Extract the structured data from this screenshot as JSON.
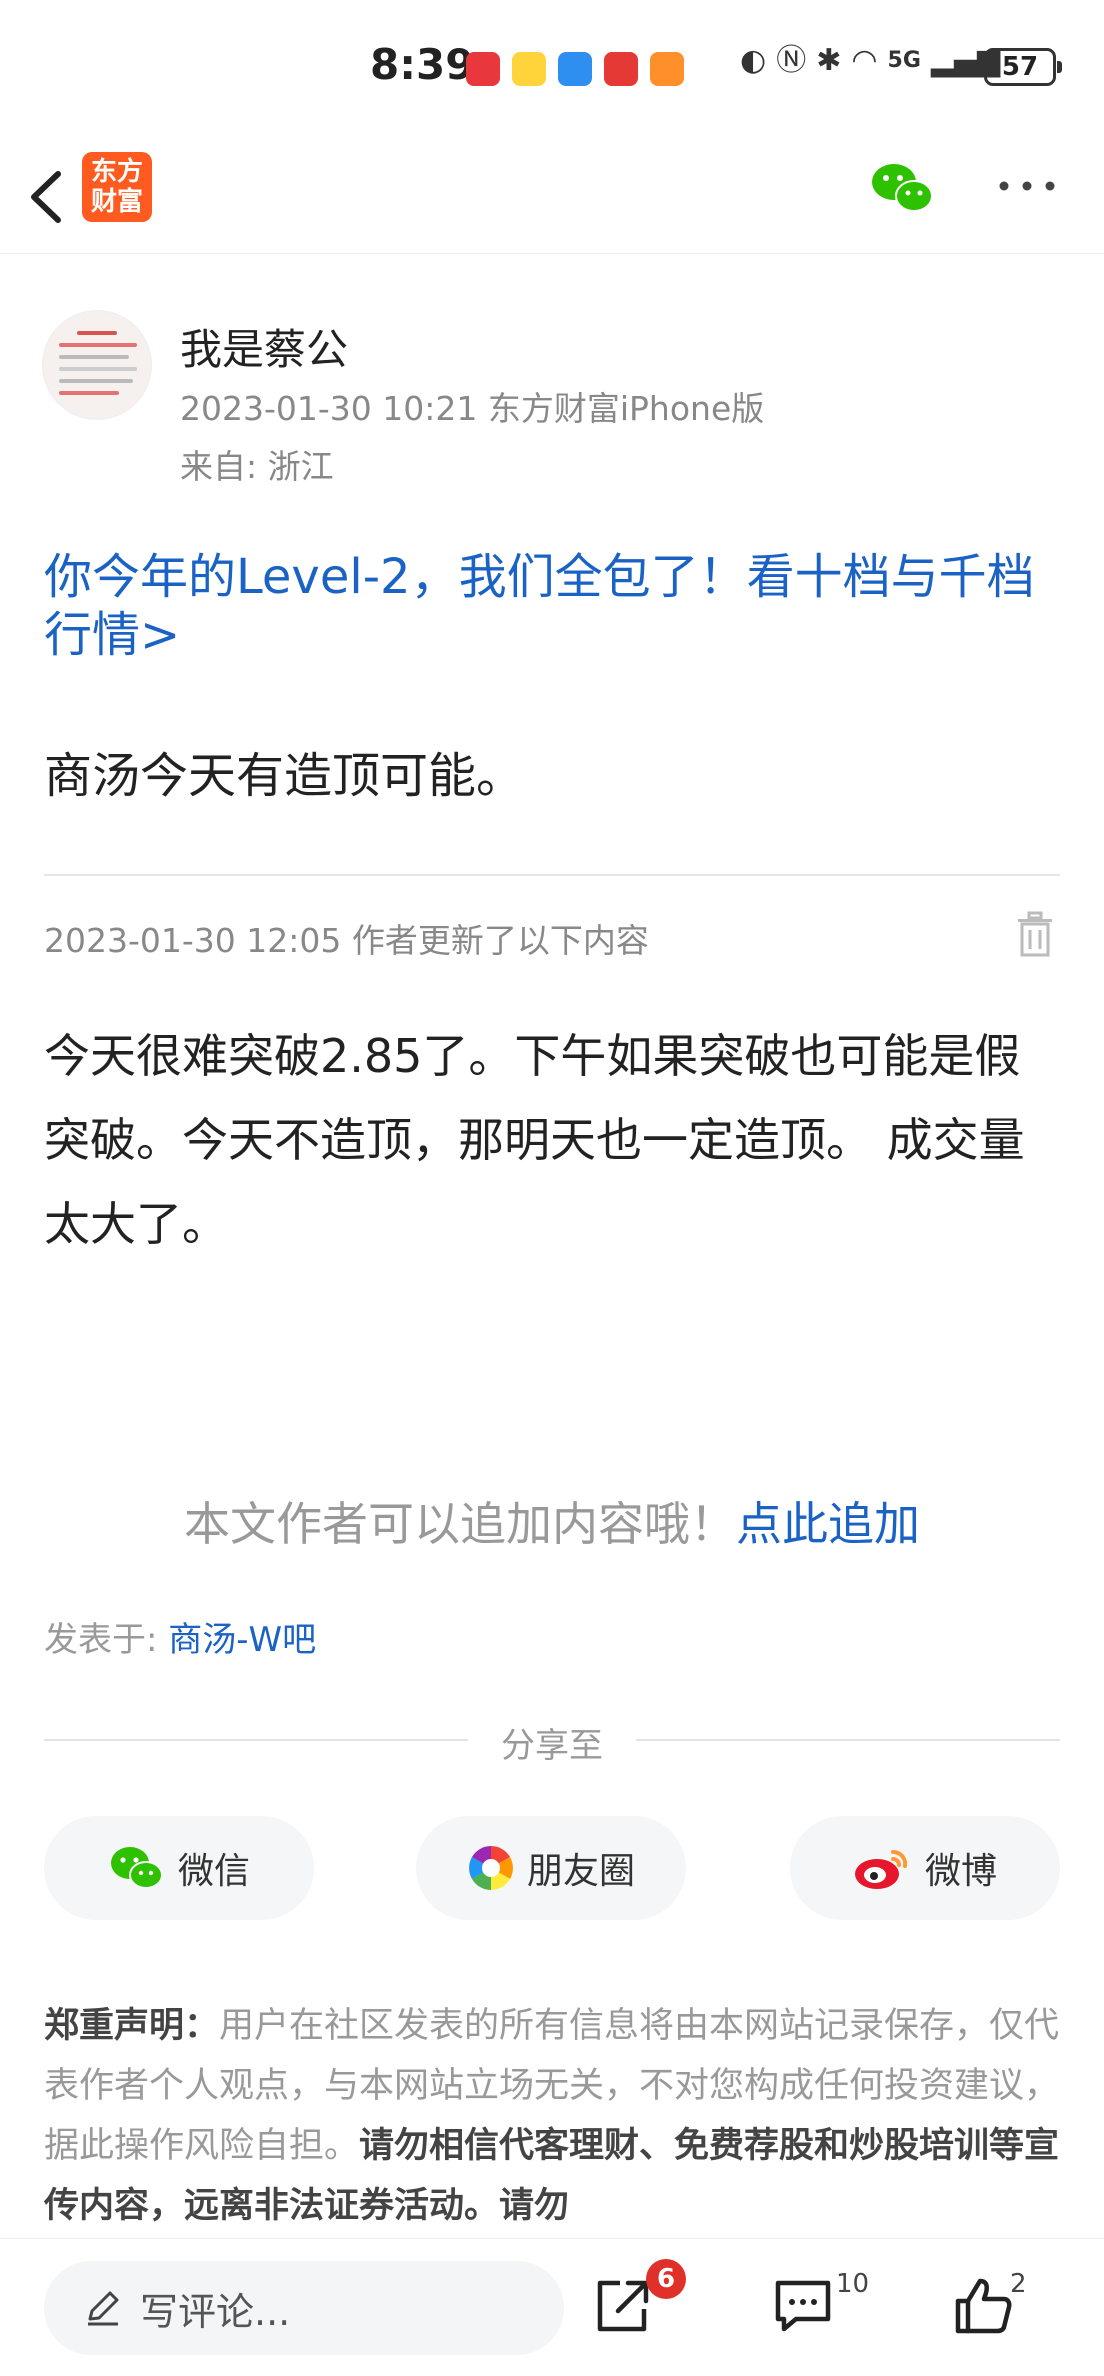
{
  "status_bar": {
    "time": "8:39",
    "battery": "57",
    "signal_label": "5G"
  },
  "nav": {
    "logo_line1": "东方",
    "logo_line2": "财富"
  },
  "author": {
    "name": "我是蔡公",
    "meta": "2023-01-30 10:21 东方财富iPhone版",
    "location": "来自: 浙江"
  },
  "post": {
    "promo_link": "你今年的Level-2，我们全包了！看十档与千档行情>",
    "body": "商汤今天有造顶可能。"
  },
  "update": {
    "meta": "2023-01-30 12:05  作者更新了以下内容",
    "body": "今天很难突破2.85了。下午如果突破也可能是假突破。今天不造顶，那明天也一定造顶。 成交量太大了。"
  },
  "append": {
    "text": "本文作者可以追加内容哦！",
    "link": "点此追加"
  },
  "posted_in": {
    "label": "发表于: ",
    "bar": "商汤-W吧"
  },
  "share": {
    "title": "分享至",
    "wechat": "微信",
    "moments": "朋友圈",
    "weibo": "微博"
  },
  "disclaimer": {
    "title": "郑重声明",
    "colon": "：",
    "text": "用户在社区发表的所有信息将由本网站记录保存，仅代表作者个人观点，与本网站立场无关，不对您构成任何投资建议，据此操作风险自担。",
    "strong": "请勿相信代客理财、免费荐股和炒股培训等宣传内容，远离非法证券活动。请勿"
  },
  "bottom": {
    "comment_placeholder": "写评论...",
    "share_badge": "6",
    "comment_count": "10",
    "like_count": "2"
  },
  "colors": {
    "link_blue": "#1a63c5",
    "brand_orange": "#ff5a1f",
    "wechat_green": "#2dc100",
    "badge_red": "#e0302a"
  }
}
